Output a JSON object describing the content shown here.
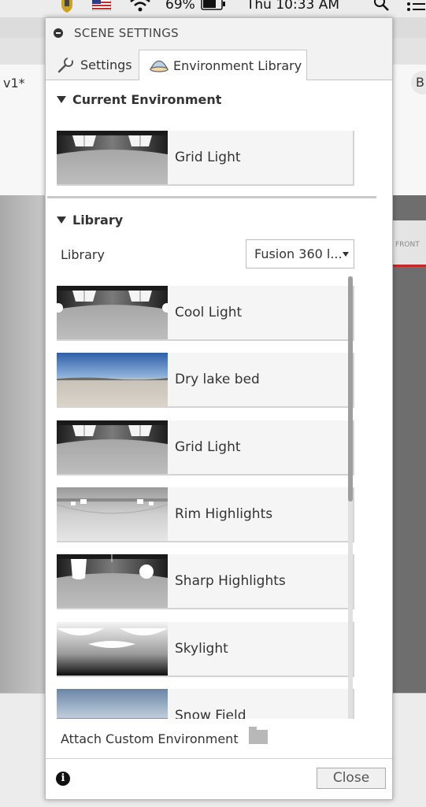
{
  "menubar": {
    "battery": "69%",
    "clock": "Thu 10:33 AM"
  },
  "background_app": {
    "doc_title": "v1*",
    "side_button": "B",
    "viewcube_label": "FRONT"
  },
  "panel": {
    "title": "SCENE SETTINGS",
    "tabs": [
      {
        "label": "Settings",
        "icon": "wrench-icon"
      },
      {
        "label": "Environment Library",
        "icon": "dome-icon",
        "active": true
      }
    ],
    "current_environment": {
      "heading": "Current Environment",
      "name": "Grid Light",
      "thumb": "grid"
    },
    "library": {
      "heading": "Library",
      "field_label": "Library",
      "select_value": "Fusion 360 l...",
      "items": [
        {
          "name": "Cool Light",
          "thumb": "cool"
        },
        {
          "name": "Dry lake bed",
          "thumb": "lake"
        },
        {
          "name": "Grid Light",
          "thumb": "grid"
        },
        {
          "name": "Rim Highlights",
          "thumb": "rim"
        },
        {
          "name": "Sharp Highlights",
          "thumb": "sharp"
        },
        {
          "name": "Skylight",
          "thumb": "sky"
        },
        {
          "name": "Snow Field",
          "thumb": "snow"
        }
      ]
    },
    "attach_label": "Attach Custom Environment",
    "close_label": "Close"
  }
}
